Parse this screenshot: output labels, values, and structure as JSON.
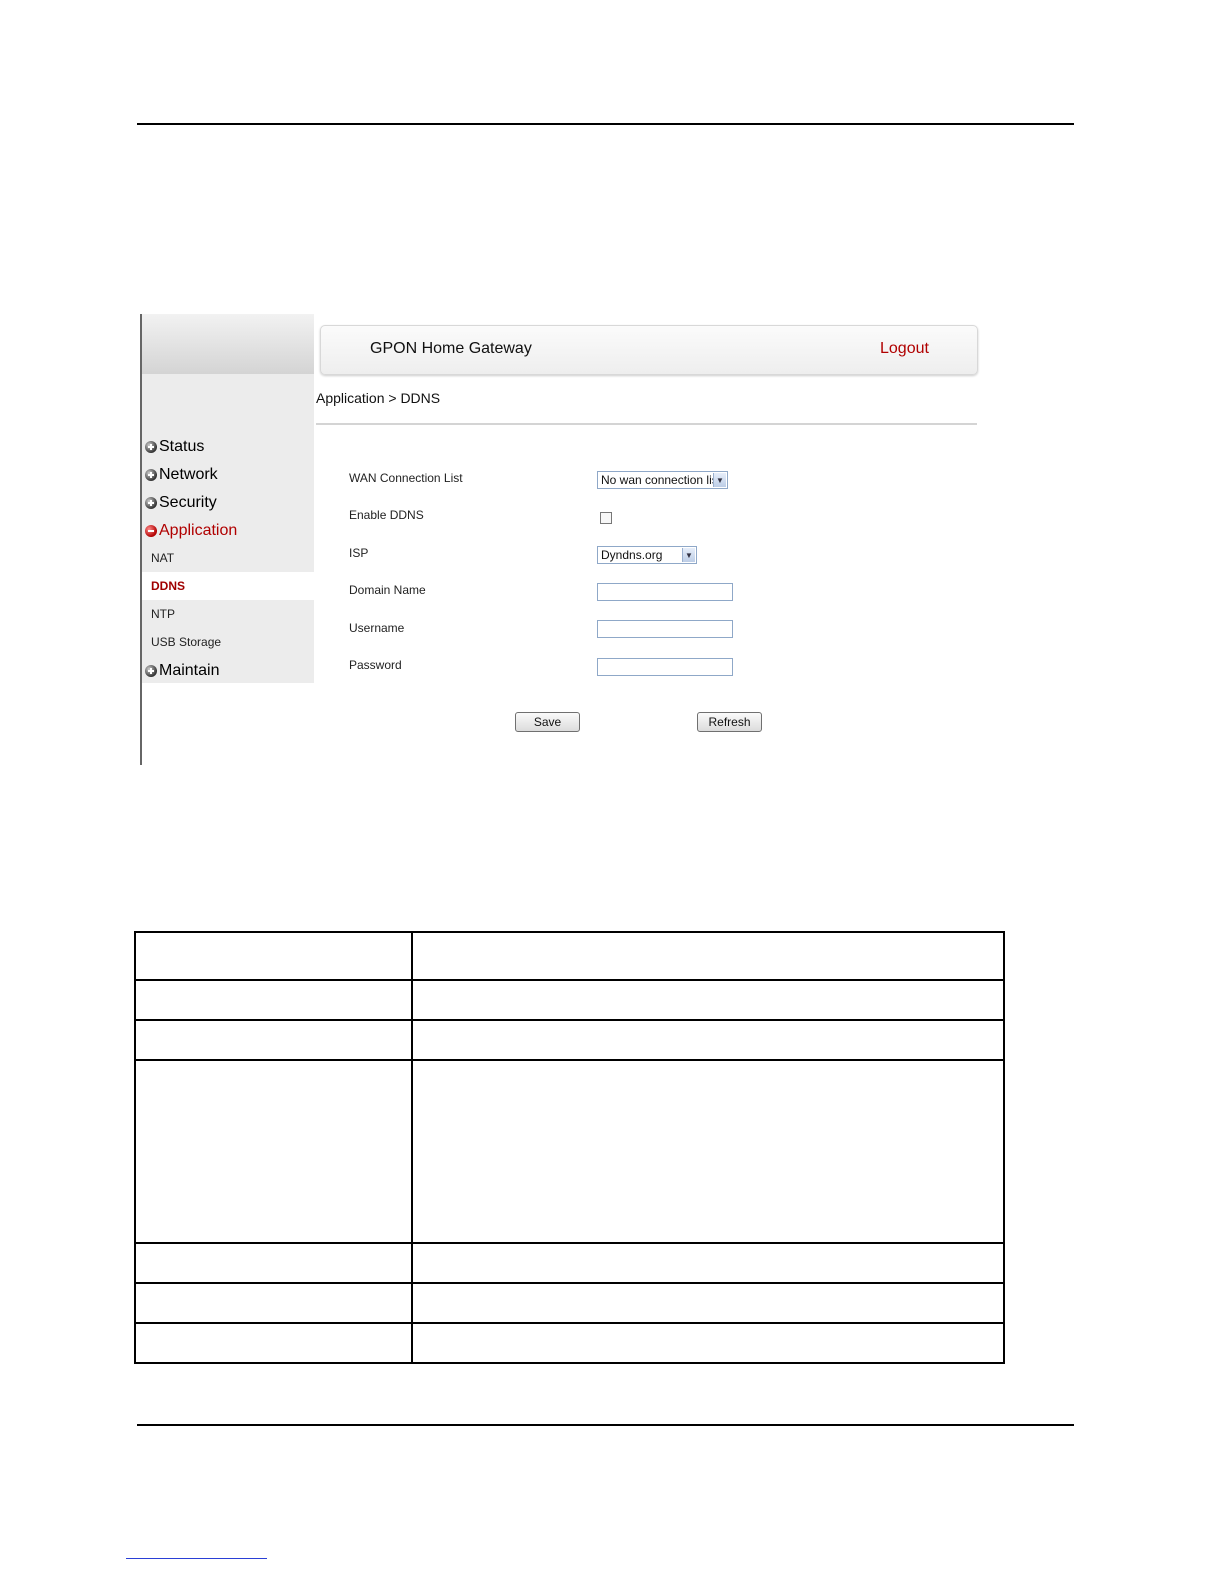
{
  "header": {
    "title": "GPON Home Gateway",
    "logout_label": "Logout"
  },
  "breadcrumb": "Application > DDNS",
  "sidebar": {
    "items": [
      {
        "label": "Status"
      },
      {
        "label": "Network"
      },
      {
        "label": "Security"
      },
      {
        "label": "Application"
      },
      {
        "label": "Maintain"
      }
    ],
    "subitems": [
      {
        "label": "NAT"
      },
      {
        "label": "DDNS"
      },
      {
        "label": "NTP"
      },
      {
        "label": "USB Storage"
      }
    ]
  },
  "form": {
    "wan_label": "WAN Connection List",
    "wan_value": "No wan connection list",
    "enable_label": "Enable DDNS",
    "isp_label": "ISP",
    "isp_value": "Dyndns.org",
    "domain_label": "Domain Name",
    "username_label": "Username",
    "password_label": "Password"
  },
  "buttons": {
    "save": "Save",
    "refresh": "Refresh"
  },
  "colors": {
    "accent_red": "#b00000",
    "sidebar_bg": "#ececec"
  },
  "icons": {
    "nav_collapsed": "plus-circle-icon",
    "nav_expanded": "minus-circle-icon",
    "dropdown": "chevron-down-icon"
  }
}
